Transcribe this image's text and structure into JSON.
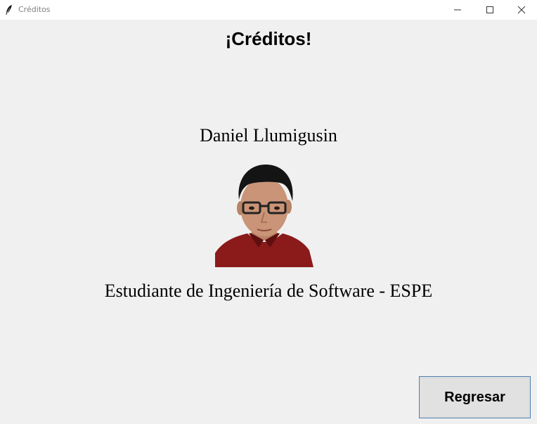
{
  "window": {
    "title": "Créditos",
    "icon": "feather-icon"
  },
  "controls": {
    "minimize_icon": "minimize-icon",
    "maximize_icon": "maximize-icon",
    "close_icon": "close-icon"
  },
  "content": {
    "heading": "¡Créditos!",
    "author_name": "Daniel Llumigusin",
    "author_description": "Estudiante de Ingeniería de Software - ESPE",
    "photo_alt": "Daniel Llumigusin"
  },
  "actions": {
    "back_label": "Regresar"
  },
  "colors": {
    "background": "#f0f0f0",
    "button_face": "#e1e1e1",
    "button_border": "#4a7fb0",
    "shirt": "#8b1a1a"
  }
}
